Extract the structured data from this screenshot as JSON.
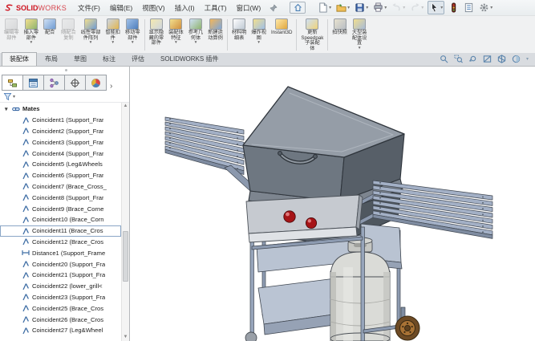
{
  "brand": {
    "name_bold": "SOLID",
    "name_light": "WORKS"
  },
  "menubar": {
    "menus": [
      "文件(F)",
      "编辑(E)",
      "视图(V)",
      "插入(I)",
      "工具(T)",
      "窗口(W)"
    ]
  },
  "quickbar": {
    "items": [
      {
        "icon": "new-document-icon",
        "dropdown": true
      },
      {
        "icon": "open-folder-icon",
        "dropdown": true
      },
      {
        "icon": "save-icon",
        "dropdown": true
      },
      {
        "icon": "print-icon",
        "dropdown": true
      },
      {
        "icon": "undo-icon",
        "dropdown": true,
        "disabled": true
      },
      {
        "icon": "redo-icon",
        "dropdown": true,
        "disabled": true
      },
      {
        "icon": "select-cursor-icon",
        "dropdown": true,
        "active": true
      },
      {
        "icon": "rebuild-icon"
      },
      {
        "icon": "file-properties-icon"
      },
      {
        "icon": "options-gear-icon",
        "dropdown": true
      }
    ]
  },
  "ribbon": {
    "buttons": [
      {
        "label": "编辑零部件",
        "lines": [
          "编辑零",
          "部件"
        ],
        "icon": "edit-component-icon",
        "disabled": true
      },
      {
        "label": "插入零部件",
        "lines": [
          "插入零",
          "部件"
        ],
        "icon": "insert-component-icon",
        "dropdown": true
      },
      {
        "label": "配合",
        "lines": [
          "配合"
        ],
        "icon": "mate-icon"
      },
      {
        "label": "随配合复制",
        "lines": [
          "随配合",
          "复制"
        ],
        "icon": "copy-with-mates-icon",
        "disabled": true
      },
      {
        "label": "线性零部件阵列",
        "lines": [
          "线性零部",
          "件阵列"
        ],
        "icon": "linear-pattern-icon",
        "dropdown": true
      },
      {
        "label": "智能扣件",
        "lines": [
          "智能扣",
          "件"
        ],
        "icon": "smart-fasteners-icon",
        "dropdown": true
      },
      {
        "label": "移动零部件",
        "lines": [
          "移动零",
          "部件"
        ],
        "icon": "move-component-icon",
        "dropdown": true,
        "sep_after": true
      },
      {
        "label": "显示隐藏的零部件",
        "lines": [
          "显示隐",
          "藏的零",
          "部件"
        ],
        "icon": "show-hidden-icon"
      },
      {
        "label": "装配体特征",
        "lines": [
          "装配体",
          "特征"
        ],
        "icon": "assembly-features-icon",
        "dropdown": true
      },
      {
        "label": "参考几何体",
        "lines": [
          "参考几",
          "何体"
        ],
        "icon": "reference-geometry-icon",
        "dropdown": true
      },
      {
        "label": "新建运动算例",
        "lines": [
          "新建运",
          "动算例"
        ],
        "icon": "motion-study-icon",
        "sep_after": true
      },
      {
        "label": "材料明细表",
        "lines": [
          "材料明",
          "细表"
        ],
        "icon": "bom-icon"
      },
      {
        "label": "爆炸视图",
        "lines": [
          "爆炸视",
          "图"
        ],
        "icon": "exploded-view-icon",
        "dropdown": true
      },
      {
        "label": "Instant3D",
        "lines": [
          "Instant3D"
        ],
        "icon": "instant3d-icon",
        "sep_after": true
      },
      {
        "label": "更新Speedpak子装配体",
        "lines": [
          "更新",
          "Speedpak",
          "子装配",
          "体"
        ],
        "icon": "update-speedpak-icon",
        "sep_after": true
      },
      {
        "label": "拍快照",
        "lines": [
          "拍快照"
        ],
        "icon": "snapshot-icon"
      },
      {
        "label": "大型装配体设置",
        "lines": [
          "大型装",
          "配体设",
          "置"
        ],
        "icon": "large-assembly-icon",
        "dropdown": true
      }
    ]
  },
  "tabs": {
    "items": [
      "装配体",
      "布局",
      "草图",
      "标注",
      "评估",
      "SOLIDWORKS 插件"
    ],
    "active_index": 0
  },
  "headsup": {
    "icons": [
      "zoom-fit-icon",
      "zoom-area-icon",
      "previous-view-icon",
      "section-view-icon",
      "display-style-icon",
      "view-settings-icon"
    ]
  },
  "panel": {
    "tabs": [
      "featuremanager-tree-icon",
      "propertymanager-icon",
      "configurationmanager-icon",
      "dimxpertmanager-icon",
      "displaymanager-icon"
    ],
    "overflow_arrow": "›",
    "tree": {
      "root_label": "Mates",
      "items": [
        {
          "label": "Coincident1 (Support_Frar",
          "icon": "coincident"
        },
        {
          "label": "Coincident2 (Support_Frar",
          "icon": "coincident"
        },
        {
          "label": "Coincident3 (Support_Frar",
          "icon": "coincident"
        },
        {
          "label": "Coincident4 (Support_Frar",
          "icon": "coincident"
        },
        {
          "label": "Coincident5 (Leg&Wheels",
          "icon": "coincident"
        },
        {
          "label": "Coincident6 (Support_Frar",
          "icon": "coincident"
        },
        {
          "label": "Coincident7 (Brace_Cross_",
          "icon": "coincident"
        },
        {
          "label": "Coincident8 (Support_Frar",
          "icon": "coincident"
        },
        {
          "label": "Coincident9 (Brace_Corne",
          "icon": "coincident"
        },
        {
          "label": "Coincident10 (Brace_Corn",
          "icon": "coincident"
        },
        {
          "label": "Coincident11 (Brace_Cros",
          "icon": "coincident",
          "selected": true
        },
        {
          "label": "Coincident12 (Brace_Cros",
          "icon": "coincident"
        },
        {
          "label": "Distance1 (Support_Frame",
          "icon": "distance"
        },
        {
          "label": "Coincident20 (Support_Fra",
          "icon": "coincident"
        },
        {
          "label": "Coincident21 (Support_Fra",
          "icon": "coincident"
        },
        {
          "label": "Coincident22 (lower_grill<",
          "icon": "coincident"
        },
        {
          "label": "Coincident23 (Support_Fra",
          "icon": "coincident"
        },
        {
          "label": "Coincident25 (Brace_Cros",
          "icon": "coincident"
        },
        {
          "label": "Coincident26 (Brace_Cros",
          "icon": "coincident"
        },
        {
          "label": "Coincident27 (Leg&Wheel",
          "icon": "coincident"
        }
      ]
    }
  }
}
